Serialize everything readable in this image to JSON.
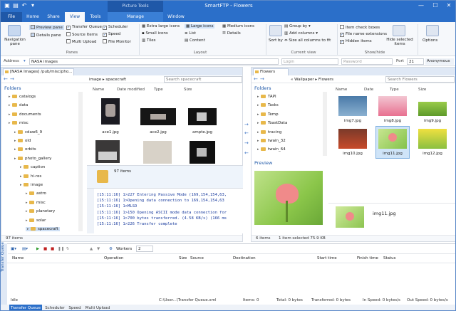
{
  "window": {
    "title": "SmartFTP - Flowers",
    "context_group": "Picture Tools",
    "minimize": "—",
    "maximize": "☐",
    "close": "✕"
  },
  "ribbon_tabs": [
    "File",
    "Home",
    "Share",
    "View",
    "Tools",
    "Manage",
    "Window"
  ],
  "active_tab": "View",
  "ribbon": {
    "navigation_pane": "Navigation pane",
    "preview_pane": "Preview pane",
    "details_pane": "Details pane",
    "transfer_queue": "Transfer Queue",
    "source_items": "Source Items",
    "multi_upload": "Multi Upload",
    "scheduler": "Scheduler",
    "speed": "Speed",
    "file_monitor": "File Monitor",
    "panes_label": "Panes",
    "layout": [
      "Extra large icons",
      "Large icons",
      "Medium icons",
      "Small icons",
      "List",
      "Details",
      "Tiles",
      "Content"
    ],
    "layout_label": "Layout",
    "sort_by": "Sort by",
    "group_by": "Group by",
    "add_columns": "Add columns",
    "size_all_columns": "Size all columns to fit",
    "current_view_label": "Current view",
    "item_check_boxes": "Item check boxes",
    "file_name_extensions": "File name extensions",
    "hidden_items": "Hidden items",
    "hide_selected_items": "Hide selected items",
    "show_hide_label": "Show/hide",
    "options": "Options"
  },
  "address_bar": {
    "address_label": "Address",
    "address_value": "NASA images",
    "login_placeholder": "Login",
    "password_placeholder": "Password",
    "port_label": "Port",
    "port_value": "21",
    "anonymous": "Anonymous"
  },
  "left_pane": {
    "tab_label": "[NASA Images] /pub/misc/pho...",
    "path": "image ▸ spacecraft",
    "search_placeholder": "Search spacecraft",
    "folders_header": "Folders",
    "tree": [
      "catalogs",
      "data",
      "documents",
      "misc",
      "cdaw6_9",
      "old",
      "orbits",
      "photo_gallery",
      "caption",
      "hi-res",
      "image",
      "astro",
      "misc",
      "planetary",
      "solar",
      "spacecraft"
    ],
    "columns": [
      "Name",
      "Date modified",
      "Type",
      "Size"
    ],
    "files": [
      "ace1.jpg",
      "ace2.jpg",
      "ampte.jpg"
    ],
    "folder_items": "97 items",
    "status": "97 items",
    "log": [
      "[15:11:16] 1>227 Entering Passive Mode (169,154,154,63,",
      "[15:11:16] 1>Opening data connection to 169,154,154,63",
      "[15:11:16] 1>MLSD",
      "[15:11:16] 1>150 Opening ASCII mode data connection for",
      "[15:11:16] 1>700 bytes transferred. (4.58 KB/s) (166 ms",
      "[15:11:16] 1>226 Transfer complete"
    ]
  },
  "right_pane": {
    "tab_label": "Flowers",
    "path": "« Wallpaper ▸ Flowers",
    "search_placeholder": "Search Flowers",
    "folders_header": "Folders",
    "tree": [
      "TAPI",
      "Tasks",
      "Temp",
      "ToastData",
      "tracing",
      "twain_32",
      "twain_64"
    ],
    "preview_header": "Preview",
    "columns": [
      "Name",
      "Date",
      "Type",
      "Size"
    ],
    "files": [
      "img7.jpg",
      "img8.jpg",
      "img9.jpg",
      "img10.jpg",
      "img11.jpg",
      "img12.jpg"
    ],
    "selected_file": "img11.jpg",
    "status_items": "6 items",
    "status_selected": "1 item selected  75.9 KB"
  },
  "transfer_queue": {
    "title": "Transfer Queue",
    "workers_label": "Workers",
    "workers_value": "2",
    "columns": [
      "Name",
      "Operation",
      "Size",
      "Source",
      "Destination",
      "Start time",
      "Finish time",
      "Status"
    ],
    "status_idle": "Idle",
    "status_file": "C:\\User...\\Transfer Queue.xml",
    "status_items": "Items: 0",
    "status_total": "Total: 0 bytes",
    "status_transferred": "Transferred: 0 bytes",
    "status_in_speed": "In Speed: 0 bytes/s",
    "status_out_speed": "Out Speed: 0 bytes/s"
  },
  "bottom_tabs": [
    "Transfer Queue",
    "Scheduler",
    "Speed",
    "Multi Upload"
  ],
  "colors": {
    "accent": "#2b6fc9",
    "folder": "#e8b84a",
    "log_text": "#1a3c9e"
  }
}
